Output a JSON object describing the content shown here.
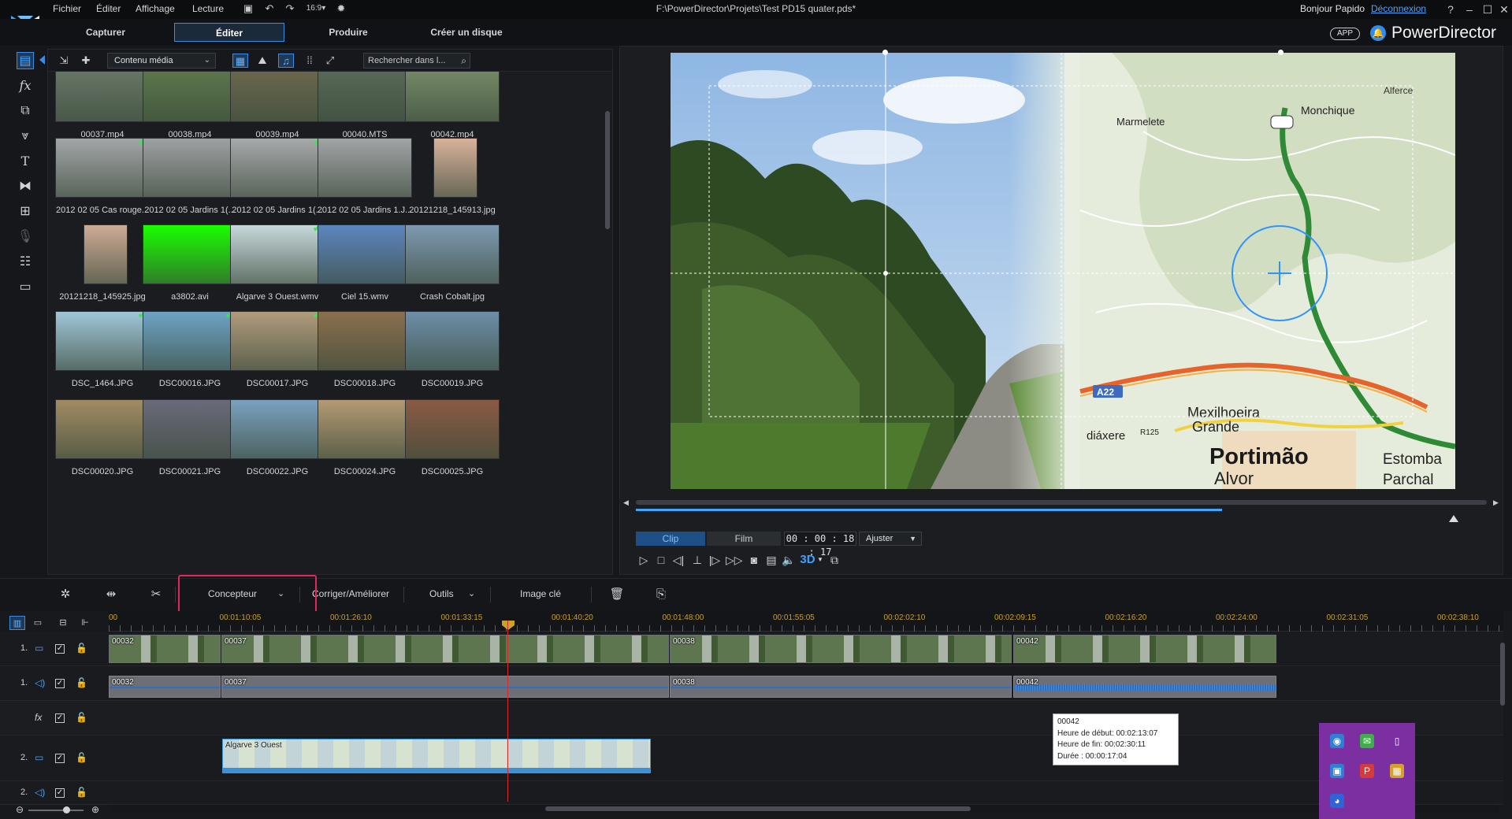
{
  "menubar": {
    "items": [
      "Fichier",
      "Éditer",
      "Affichage",
      "Lecture"
    ],
    "file_title": "F:\\PowerDirector\\Projets\\Test PD15 quater.pds*",
    "greeting": "Bonjour Papido",
    "logout": "Déconnexion",
    "help": "?"
  },
  "modules": {
    "tabs": [
      {
        "label": "Capturer"
      },
      {
        "label": "Éditer"
      },
      {
        "label": "Produire"
      },
      {
        "label": "Créer un disque"
      }
    ],
    "active": "Éditer",
    "app_badge": "APP",
    "brand": "PowerDirector"
  },
  "library": {
    "content_select": "Contenu média",
    "search_placeholder": "Rechercher dans l...",
    "items": [
      {
        "name": "00037.mp4",
        "checked": true,
        "color": "#6c7a6a"
      },
      {
        "name": "00038.mp4",
        "checked": true,
        "color": "#5f7b4d"
      },
      {
        "name": "00039.mp4",
        "checked": true,
        "color": "#6e6a4f"
      },
      {
        "name": "00040.MTS",
        "checked": false,
        "color": "#5b6b5a"
      },
      {
        "name": "00042.mp4",
        "checked": true,
        "color": "#7a8f6a"
      },
      {
        "name": "2012 02 05 Cas rouge...",
        "checked": true,
        "color": "#a3a6a8"
      },
      {
        "name": "2012 02 05 Jardins 1(...",
        "checked": false,
        "color": "#9ea1a3"
      },
      {
        "name": "2012 02 05 Jardins 1(...",
        "checked": true,
        "color": "#a7a9aa"
      },
      {
        "name": "2012 02 05 Jardins 1.J...",
        "checked": false,
        "color": "#a2a4a6"
      },
      {
        "name": "20121218_145913.jpg",
        "checked": false,
        "color": "#d9b29a"
      },
      {
        "name": "20121218_145925.jpg",
        "checked": false,
        "color": "#cfab95"
      },
      {
        "name": "a3802.avi",
        "checked": false,
        "color": "#19ff00"
      },
      {
        "name": "Algarve 3 Ouest.wmv",
        "checked": true,
        "color": "#c7d8dc"
      },
      {
        "name": "Ciel 15.wmv",
        "checked": false,
        "color": "#5d86bf"
      },
      {
        "name": "Crash Cobalt.jpg",
        "checked": false,
        "color": "#7e9ab1"
      },
      {
        "name": "DSC_1464.JPG",
        "checked": true,
        "color": "#9fc6d8"
      },
      {
        "name": "DSC00016.JPG",
        "checked": true,
        "color": "#6ea3c6"
      },
      {
        "name": "DSC00017.JPG",
        "checked": true,
        "color": "#b19b7d"
      },
      {
        "name": "DSC00018.JPG",
        "checked": false,
        "color": "#8a6f4e"
      },
      {
        "name": "DSC00019.JPG",
        "checked": false,
        "color": "#6d8ea8"
      },
      {
        "name": "DSC00020.JPG",
        "checked": false,
        "color": "#a28b63"
      },
      {
        "name": "DSC00021.JPG",
        "checked": false,
        "color": "#6a6a7a"
      },
      {
        "name": "DSC00022.JPG",
        "checked": false,
        "color": "#7ba1c0"
      },
      {
        "name": "DSC00024.JPG",
        "checked": false,
        "color": "#b39a73"
      },
      {
        "name": "DSC00025.JPG",
        "checked": false,
        "color": "#8a5a44"
      }
    ]
  },
  "preview": {
    "mode_clip": "Clip",
    "mode_film": "Film",
    "timecode": "00 : 00 : 18 : 17",
    "fit": "Ajuster",
    "three_d": "3D",
    "map_labels": {
      "alferce": "Alferce",
      "monchique": "Monchique",
      "marmelete": "Marmelete",
      "a22": "A22",
      "mexilhoeira": "Mexilhoeira",
      "grande": "Grande",
      "odiaxere": "diáxere",
      "r125": "R125",
      "portimao": "Portimão",
      "estombar": "Estomba",
      "alvor": "Alvor",
      "parchal": "Parchal"
    }
  },
  "edit_toolbar": {
    "designer": "Concepteur",
    "fix_enhance": "Corriger/Améliorer",
    "tools": "Outils",
    "keyframe": "Image clé"
  },
  "timeline": {
    "ruler": [
      "00",
      "00:01:10:05",
      "00:01:26:10",
      "00:01:33:15",
      "00:01:40:20",
      "00:01:48:00",
      "00:01:55:05",
      "00:02:02:10",
      "00:02:09:15",
      "00:02:16:20",
      "00:02:24:00",
      "00:02:31:05",
      "00:02:38:10"
    ],
    "tracks": [
      {
        "num": "1.",
        "type": "video"
      },
      {
        "num": "1.",
        "type": "audio"
      },
      {
        "num": "",
        "type": "fx"
      },
      {
        "num": "2.",
        "type": "video"
      },
      {
        "num": "2.",
        "type": "audio"
      }
    ],
    "video_clips": [
      "00032",
      "00037",
      "00038",
      "00042"
    ],
    "audio_clips": [
      "00032",
      "00037",
      "00038",
      "00042"
    ],
    "overlay_clip": "Algarve 3 Ouest",
    "tooltip": {
      "name": "00042",
      "start": "Heure de début: 00:02:13:07",
      "end": "Heure de fin: 00:02:30:11",
      "duration": "Durée : 00:00:17:04"
    }
  }
}
